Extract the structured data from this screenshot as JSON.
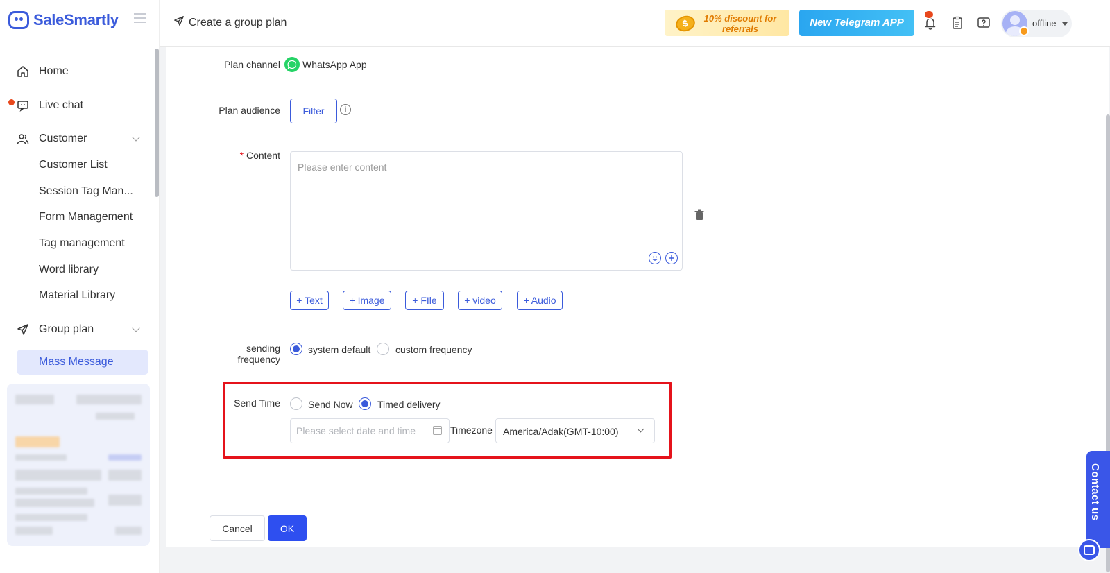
{
  "app": {
    "brand": "SaleSmartly"
  },
  "sidebar": {
    "items": [
      {
        "label": "Home",
        "icon": "home-icon"
      },
      {
        "label": "Live chat",
        "icon": "chat-icon",
        "has_notification": true
      },
      {
        "label": "Customer",
        "icon": "users-icon",
        "expanded": true
      }
    ],
    "customer_sub": [
      {
        "label": "Customer List"
      },
      {
        "label": "Session Tag Man..."
      },
      {
        "label": "Form Management"
      },
      {
        "label": "Tag management"
      },
      {
        "label": "Word library"
      },
      {
        "label": "Material Library"
      }
    ],
    "group_plan": {
      "label": "Group plan",
      "icon": "send-icon",
      "expanded": true
    },
    "group_plan_sub": [
      {
        "label": "Mass Message",
        "active": true
      }
    ]
  },
  "header": {
    "title": "Create a group plan",
    "promo1": "10% discount for referrals",
    "promo2": "New Telegram APP",
    "user_status": "offline"
  },
  "form": {
    "plan_channel": {
      "label": "Plan channel",
      "value": "WhatsApp App"
    },
    "plan_audience": {
      "label": "Plan audience",
      "button": "Filter"
    },
    "content": {
      "required_mark": "*",
      "label": "Content",
      "placeholder": "Please enter content",
      "add_buttons": [
        "+ Text",
        "+ Image",
        "+ FIle",
        "+ video",
        "+ Audio"
      ]
    },
    "sending_frequency": {
      "label": "sending frequency",
      "options": [
        "system default",
        "custom frequency"
      ],
      "selected": "system default"
    },
    "send_time": {
      "label": "Send Time",
      "options": [
        "Send Now",
        "Timed delivery"
      ],
      "selected": "Timed delivery",
      "date_placeholder": "Please select date and time",
      "timezone_label": "Timezone",
      "timezone_value": "America/Adak(GMT-10:00)"
    },
    "actions": {
      "cancel": "Cancel",
      "ok": "OK"
    }
  },
  "contact_us": "Contact us",
  "colors": {
    "accent": "#3b5bdb",
    "primary_button": "#2e4ff0",
    "highlight_border": "#e5131b",
    "whatsapp": "#25d366"
  }
}
